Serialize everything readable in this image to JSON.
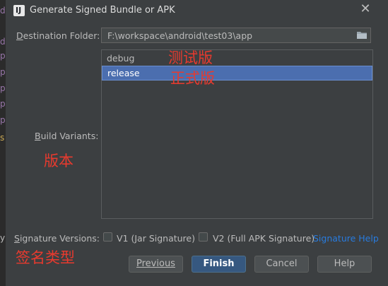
{
  "window": {
    "title": "Generate Signed Bundle or APK",
    "icon_letter": "IJ"
  },
  "background": {
    "chars": [
      "d",
      "d",
      "p",
      "p",
      "p",
      "p",
      "p",
      "s",
      "y"
    ]
  },
  "destination": {
    "label_underline": "D",
    "label_rest": "estination Folder:",
    "value": "F:\\workspace\\android\\test03\\app"
  },
  "build_variants": {
    "label_underline": "B",
    "label_rest": "uild Variants:",
    "items": [
      "debug",
      "release"
    ],
    "selected": "release"
  },
  "annotations": {
    "debug": "测试版",
    "release": "正式版",
    "version": "版本",
    "sig_type": "签名类型"
  },
  "signature": {
    "label_underline": "S",
    "label_rest": "ignature Versions:",
    "v1_label": "V1 (Jar Signature)",
    "v1_underline": "J",
    "v2_label": "V2 (Full APK Signature)",
    "v2_underline": "A",
    "help": "Signature Help"
  },
  "buttons": {
    "previous": "Previous",
    "finish": "Finish",
    "cancel": "Cancel",
    "help": "Help"
  },
  "colors": {
    "accent": "#4b6eaf",
    "annotation": "#e83a2e",
    "link": "#287bde"
  }
}
